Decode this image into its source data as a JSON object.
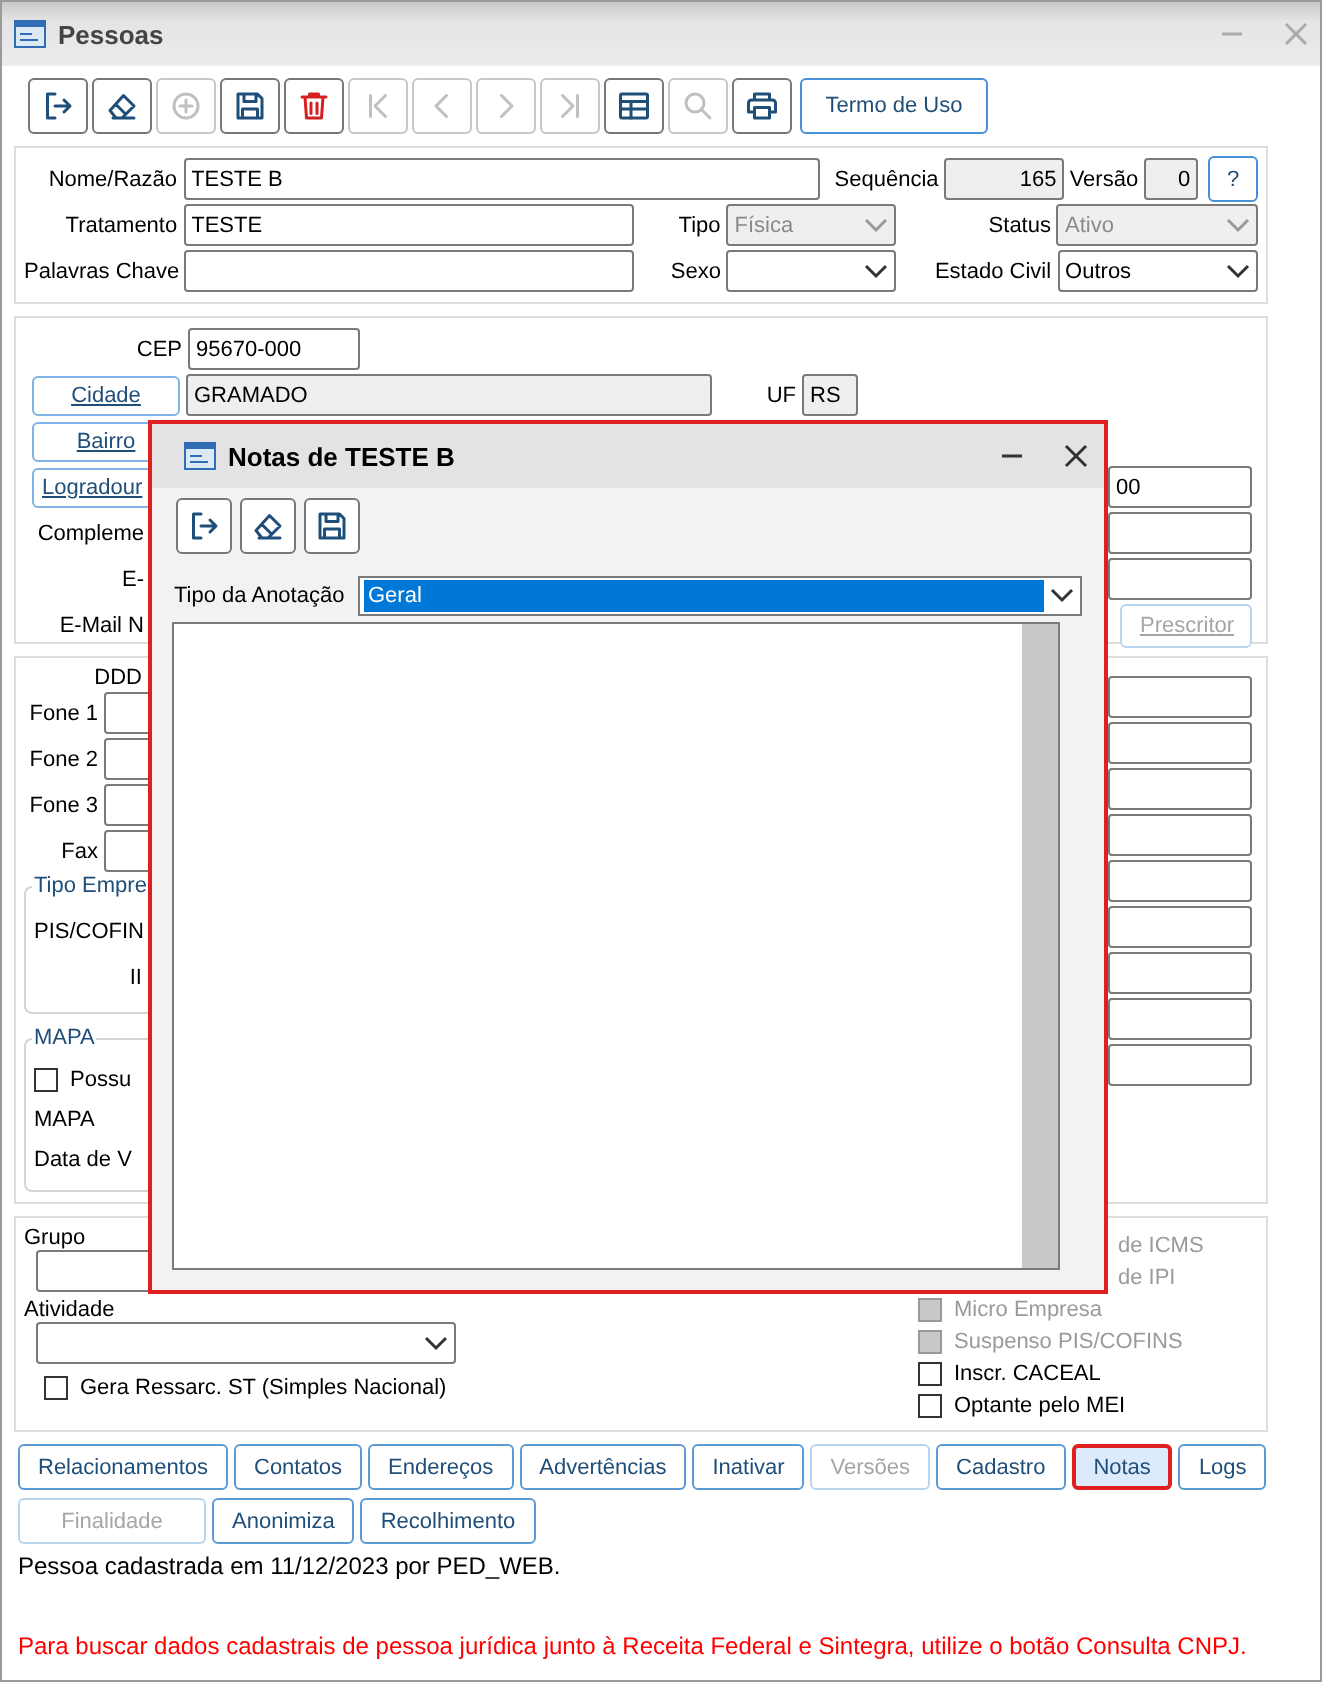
{
  "window": {
    "title": "Pessoas"
  },
  "toolbar": [
    {
      "kind": "exit",
      "disabled": false
    },
    {
      "kind": "eraser",
      "disabled": false
    },
    {
      "kind": "add",
      "disabled": true
    },
    {
      "kind": "save",
      "disabled": false
    },
    {
      "kind": "delete",
      "disabled": false
    },
    {
      "kind": "first",
      "disabled": true
    },
    {
      "kind": "prev",
      "disabled": true
    },
    {
      "kind": "next",
      "disabled": true
    },
    {
      "kind": "last",
      "disabled": true
    },
    {
      "kind": "grid",
      "disabled": false
    },
    {
      "kind": "search",
      "disabled": true
    },
    {
      "kind": "print",
      "disabled": false
    }
  ],
  "terms_button": "Termo de Uso",
  "identity": {
    "name_label": "Nome/Razão",
    "name": "TESTE B",
    "sequence_label": "Sequência",
    "sequence": "165",
    "version_label": "Versão",
    "version": "0",
    "help": "?",
    "title_label": "Tratamento",
    "title": "TESTE",
    "keywords_label": "Palavras Chave",
    "type": {
      "label": "Tipo",
      "value": "Física",
      "disabled": true
    },
    "status": {
      "label": "Status",
      "value": "Ativo",
      "disabled": true
    },
    "sex": {
      "label": "Sexo",
      "disabled": false
    },
    "civil": {
      "label": "Estado Civil",
      "value": "Outros",
      "disabled": false
    }
  },
  "address": {
    "cep_label": "CEP",
    "cep": "95670-000",
    "city_button": "Cidade",
    "city": "GRAMADO",
    "uf_label": "UF",
    "uf": "RS",
    "district_button": "Bairro",
    "street_button": "Logradour",
    "street_tail": "00",
    "complement_label": "Compleme",
    "email_label": "E-",
    "email_n_label": "E-Mail N",
    "prescriber_button": {
      "label": "Prescritor",
      "disabled": true
    }
  },
  "contacts": {
    "ddd_label": "DDD",
    "phones": [
      "Fone 1",
      "Fone 2",
      "Fone 3",
      "Fax"
    ],
    "company_legend": "Tipo Empre",
    "pis_label": "PIS/COFIN",
    "ii_label": "II",
    "map_legend": "MAPA",
    "has_map": {
      "label": "Possu",
      "checked": false
    },
    "map_label": "MAPA",
    "date_label": "Data de V"
  },
  "extra": {
    "group_label": "Grupo",
    "activity_label": "Atividade",
    "st": {
      "label": "Gera Ressarc. ST (Simples Nacional)",
      "checked": false
    },
    "partial_flags": [
      {
        "label": "de ICMS",
        "disabled": true
      },
      {
        "label": "de IPI",
        "disabled": true
      }
    ],
    "flags": [
      {
        "label": "Micro Empresa",
        "disabled": true,
        "checked": false
      },
      {
        "label": "Suspenso PIS/COFINS",
        "disabled": true,
        "checked": false
      },
      {
        "label": "Inscr. CACEAL",
        "disabled": false,
        "checked": false
      },
      {
        "label": "Optante pelo MEI",
        "disabled": false,
        "checked": false
      }
    ]
  },
  "actions": [
    [
      {
        "label": "Relacionamentos",
        "disabled": false,
        "selected": false
      },
      {
        "label": "Contatos",
        "disabled": false,
        "selected": false
      },
      {
        "label": "Endereços",
        "disabled": false,
        "selected": false
      },
      {
        "label": "Advertências",
        "disabled": false,
        "selected": false
      },
      {
        "label": "Inativar",
        "disabled": false,
        "selected": false
      },
      {
        "label": "Versões",
        "disabled": true,
        "selected": false
      },
      {
        "label": "Cadastro",
        "disabled": false,
        "selected": false
      },
      {
        "label": "Notas",
        "disabled": false,
        "selected": true
      },
      {
        "label": "Logs",
        "disabled": false,
        "selected": false
      }
    ],
    [
      {
        "label": "Finalidade",
        "disabled": true,
        "selected": false
      },
      {
        "label": "Anonimiza",
        "disabled": false,
        "selected": false
      },
      {
        "label": "Recolhimento",
        "disabled": false,
        "selected": false
      }
    ]
  ],
  "status_text": "Pessoa cadastrada em 11/12/2023 por PED_WEB.",
  "notice": "Para buscar dados cadastrais de pessoa jurídica junto à Receita Federal e Sintegra, utilize o botão Consulta CNPJ.",
  "dialog": {
    "title": "Notas de TESTE B",
    "toolbar": [
      {
        "kind": "exit",
        "disabled": false
      },
      {
        "kind": "eraser",
        "disabled": false
      },
      {
        "kind": "save",
        "disabled": false
      }
    ],
    "type_label": "Tipo da Anotação",
    "type_value": "Geral",
    "type_focused": true
  }
}
